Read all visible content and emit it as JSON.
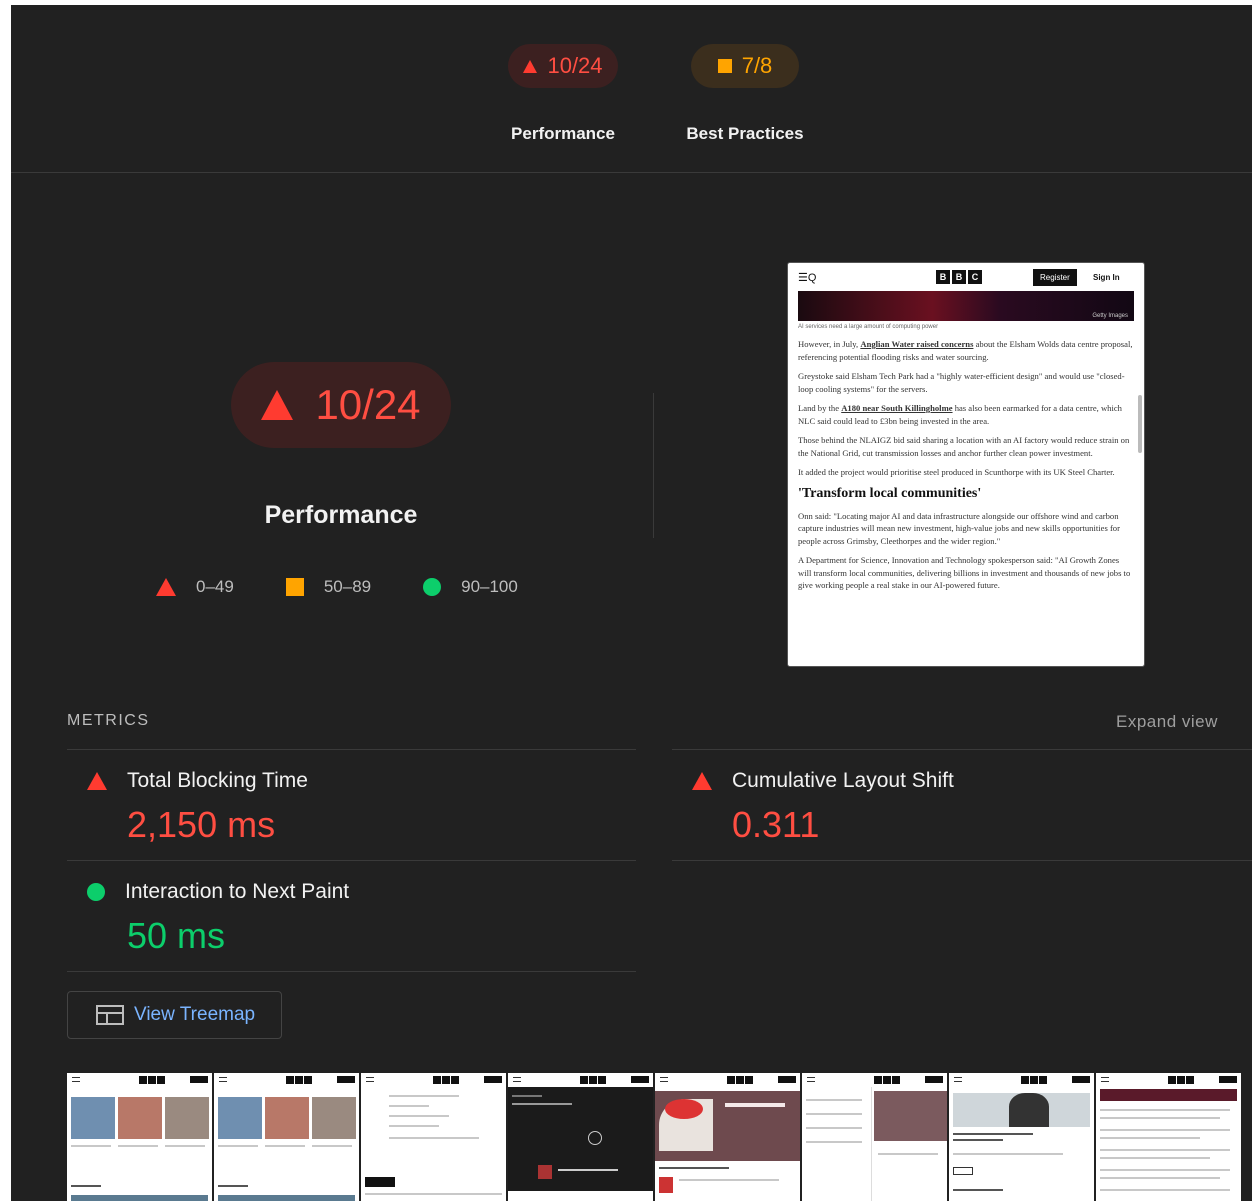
{
  "summary": {
    "performance": {
      "score": "10/24",
      "label": "Performance"
    },
    "best_practices": {
      "score": "7/8",
      "label": "Best Practices"
    }
  },
  "main": {
    "score": "10/24",
    "title": "Performance",
    "legend": [
      {
        "range": "0–49",
        "icon": "triangle-icon"
      },
      {
        "range": "50–89",
        "icon": "square-icon"
      },
      {
        "range": "90–100",
        "icon": "circle-icon"
      }
    ]
  },
  "screenshot": {
    "register": "Register",
    "signin": "Sign In",
    "getty": "Getty Images",
    "caption": "AI services need a large amount of computing power",
    "p1_a": "However, in July, ",
    "p1_link": "Anglian Water raised concerns",
    "p1_b": " about the Elsham Wolds data centre proposal, referencing potential flooding risks and water sourcing.",
    "p2": "Greystoke said Elsham Tech Park had a \"highly water-efficient design\" and would use \"closed-loop cooling systems\" for the servers.",
    "p3_a": "Land by the ",
    "p3_link": "A180 near South Killingholme",
    "p3_b": " has also been earmarked for a data centre, which NLC said could lead to £3bn being invested in the area.",
    "p4": "Those behind the NLAIGZ bid said sharing a location with an AI factory would reduce strain on the National Grid, cut transmission losses and anchor further clean power investment.",
    "p5": "It added the project would prioritise steel produced in Scunthorpe with its UK Steel Charter.",
    "heading": "'Transform local communities'",
    "p6": "Onn said: \"Locating major AI and data infrastructure alongside our offshore wind and carbon capture industries will mean new investment, high-value jobs and new skills opportunities for people across Grimsby, Cleethorpes and the wider region.\"",
    "p7": "A Department for Science, Innovation and Technology spokesperson said: \"AI Growth Zones will transform local communities, delivering billions in investment and thousands of new jobs to give working people a real stake in our AI-powered future."
  },
  "metrics": {
    "heading": "METRICS",
    "expand": "Expand view",
    "items": [
      {
        "title": "Total Blocking Time",
        "value": "2,150 ms",
        "status": "fail"
      },
      {
        "title": "Cumulative Layout Shift",
        "value": "0.311",
        "status": "fail"
      },
      {
        "title": "Interaction to Next Paint",
        "value": "50 ms",
        "status": "pass"
      }
    ]
  },
  "treemap": {
    "label": "View Treemap"
  },
  "colors": {
    "fail": "#ff4e42",
    "average": "#ffa400",
    "pass": "#0cce6b",
    "link": "#7ab4ff",
    "background": "#212121"
  }
}
